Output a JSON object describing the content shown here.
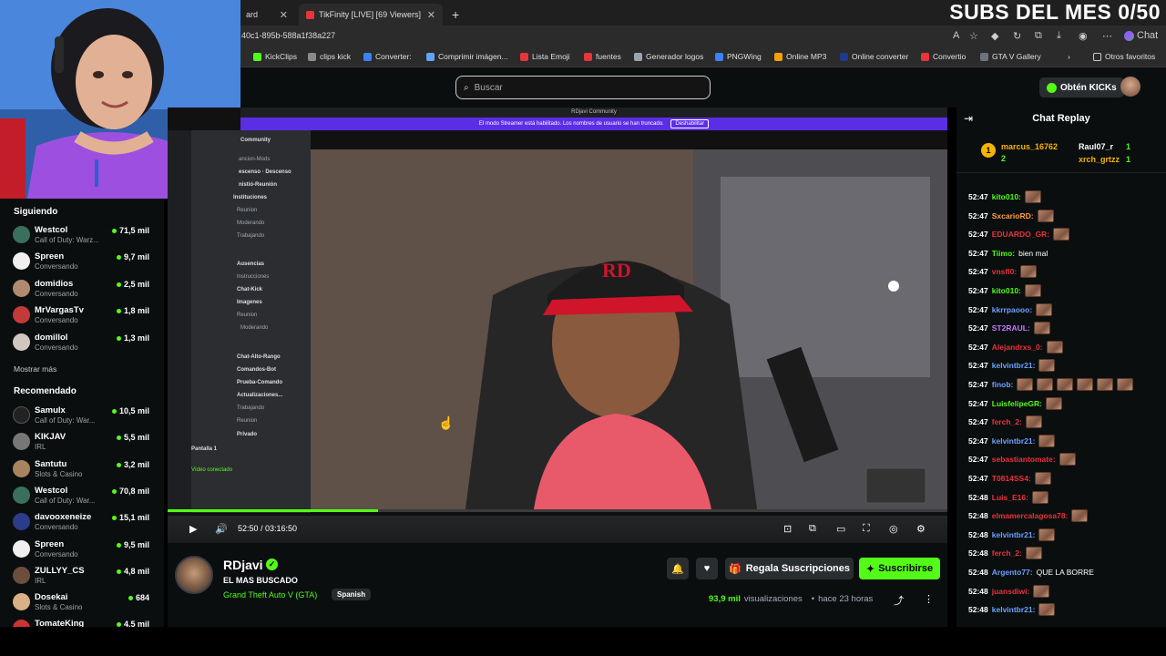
{
  "browser": {
    "tabs": [
      {
        "label": "ard",
        "active": false
      },
      {
        "label": "TikFinity [LIVE] [69 Viewers]",
        "active": false
      }
    ],
    "url": "40c1-895b-588a1f38a227",
    "chat_label": "Chat",
    "bookmarks": [
      "KickClips",
      "clips kick",
      "Converter:",
      "Comprimir imágen...",
      "Lista Emoji",
      "fuentes",
      "Generador logos",
      "PNGWing",
      "Online MP3",
      "Online converter",
      "Convertio",
      "GTA V Gallery"
    ],
    "other_favorites": "Otros favoritos"
  },
  "overlay": {
    "subs": "SUBS DEL MES 0/50"
  },
  "header": {
    "search_placeholder": "Buscar",
    "get_kicks": "Obtén KICKs"
  },
  "sidebar": {
    "following_title": "Siguiendo",
    "following": [
      {
        "name": "Westcol",
        "category": "Call of Duty: Warz...",
        "viewers": "71,5 mil"
      },
      {
        "name": "Spreen",
        "category": "Conversando",
        "viewers": "9,7 mil"
      },
      {
        "name": "domidios",
        "category": "Conversando",
        "viewers": "2,5 mil"
      },
      {
        "name": "MrVargasTv",
        "category": "Conversando",
        "viewers": "1,8 mil"
      },
      {
        "name": "domillol",
        "category": "Conversando",
        "viewers": "1,3 mil"
      }
    ],
    "show_more": "Mostrar más",
    "recommended_title": "Recomendado",
    "recommended": [
      {
        "name": "Samulx",
        "category": "Call of Duty: War...",
        "viewers": "10,5 mil"
      },
      {
        "name": "KIKJAV",
        "category": "IRL",
        "viewers": "5,5 mil"
      },
      {
        "name": "Santutu",
        "category": "Slots & Casino",
        "viewers": "3,2 mil"
      },
      {
        "name": "Westcol",
        "category": "Call of Duty: War...",
        "viewers": "70,8 mil"
      },
      {
        "name": "davooxeneize",
        "category": "Conversando",
        "viewers": "15,1 mil"
      },
      {
        "name": "Spreen",
        "category": "Conversando",
        "viewers": "9,5 mil"
      },
      {
        "name": "ZULLYY_CS",
        "category": "IRL",
        "viewers": "4,8 mil"
      },
      {
        "name": "Dosekai",
        "category": "Slots & Casino",
        "viewers": "684"
      },
      {
        "name": "TomateKing",
        "category": "",
        "viewers": "4,5 mil"
      }
    ]
  },
  "video": {
    "discord_title": "RDjavi Community",
    "streamer_mode_text": "El modo Streamer está habilitado. Los nombres de usuario se han truncado.",
    "streamer_mode_button": "Deshabilitar",
    "discord_server": "Community",
    "discord_channels": [
      "Instituciones",
      "Reunion",
      "Moderando",
      "Trabajando",
      "Ausencias",
      "Instrucciones",
      "Chat-Kick",
      "Imagenes",
      "Reunion",
      "Moderando",
      "Chat-Alto-Rango",
      "Comandos-Bot",
      "Prueba-Comando",
      "Actualizaciones...",
      "Trabajando",
      "Reunion",
      "Privado"
    ],
    "discord_top_lines": [
      "ancion-Mods",
      "escenso · Descenso",
      "nistió-Reunión"
    ],
    "screen_share": "Pantalla 1",
    "video_connected": "Vídeo conectado",
    "time": "52:50 / 03:16:50",
    "progress": 0.27
  },
  "stream": {
    "name": "RDjavi",
    "title": "EL MAS BUSCADO",
    "category": "Grand Theft Auto V (GTA)",
    "language": "Spanish",
    "gift_subs": "Regala Suscripciones",
    "subscribe": "Suscribirse",
    "views_count": "93,9 mil",
    "views_label": "visualizaciones",
    "ago": "hace 23 horas"
  },
  "chat": {
    "title": "Chat Replay",
    "leaderboard": [
      {
        "name": "marcus_16762",
        "count": "2"
      },
      {
        "name": "Raul07_r",
        "count": "1"
      },
      {
        "name": "xrch_grtzz",
        "count": "1"
      }
    ],
    "messages": [
      {
        "time": "52:47",
        "user": "kito010:",
        "color": "#53fc18",
        "text": "",
        "emotes": 1
      },
      {
        "time": "52:47",
        "user": "SxcarioRD:",
        "color": "#ff9f40",
        "text": "",
        "emotes": 1
      },
      {
        "time": "52:47",
        "user": "EDUARDO_GR:",
        "color": "#e8343a",
        "text": "",
        "emotes": 1
      },
      {
        "time": "52:47",
        "user": "Tiimo:",
        "color": "#53fc18",
        "text": "bien mal",
        "emotes": 0
      },
      {
        "time": "52:47",
        "user": "vnsfl0:",
        "color": "#e8343a",
        "text": "",
        "emotes": 1
      },
      {
        "time": "52:47",
        "user": "kito010:",
        "color": "#53fc18",
        "text": "",
        "emotes": 1
      },
      {
        "time": "52:47",
        "user": "kkrrpaooo:",
        "color": "#6ba2ff",
        "text": "",
        "emotes": 1
      },
      {
        "time": "52:47",
        "user": "ST2RAUL:",
        "color": "#c27bff",
        "text": "",
        "emotes": 1
      },
      {
        "time": "52:47",
        "user": "Alejandrxs_0:",
        "color": "#e8343a",
        "text": "",
        "emotes": 1
      },
      {
        "time": "52:47",
        "user": "kelvintbr21:",
        "color": "#6ba2ff",
        "text": "",
        "emotes": 1
      },
      {
        "time": "52:47",
        "user": "finob:",
        "color": "#6ba2ff",
        "text": "",
        "emotes": 6
      },
      {
        "time": "52:47",
        "user": "LuisfelipeGR:",
        "color": "#53fc18",
        "text": "",
        "emotes": 1
      },
      {
        "time": "52:47",
        "user": "ferch_2:",
        "color": "#e8343a",
        "text": "",
        "emotes": 1
      },
      {
        "time": "52:47",
        "user": "kelvintbr21:",
        "color": "#6ba2ff",
        "text": "",
        "emotes": 1
      },
      {
        "time": "52:47",
        "user": "sebastiantomate:",
        "color": "#e8343a",
        "text": "",
        "emotes": 1
      },
      {
        "time": "52:47",
        "user": "T0814SS4:",
        "color": "#e8343a",
        "text": "",
        "emotes": 1
      },
      {
        "time": "52:48",
        "user": "Luis_E16:",
        "color": "#e8343a",
        "text": "",
        "emotes": 1
      },
      {
        "time": "52:48",
        "user": "elmamercalagosa78:",
        "color": "#e8343a",
        "text": "",
        "emotes": 1
      },
      {
        "time": "52:48",
        "user": "kelvintbr21:",
        "color": "#6ba2ff",
        "text": "",
        "emotes": 1
      },
      {
        "time": "52:48",
        "user": "ferch_2:",
        "color": "#e8343a",
        "text": "",
        "emotes": 1
      },
      {
        "time": "52:48",
        "user": "Argento77:",
        "color": "#6ba2ff",
        "text": "QUE LA BORRE",
        "emotes": 0
      },
      {
        "time": "52:48",
        "user": "juansdiwi:",
        "color": "#e8343a",
        "text": "",
        "emotes": 1
      },
      {
        "time": "52:48",
        "user": "kelvintbr21:",
        "color": "#6ba2ff",
        "text": "",
        "emotes": 1
      }
    ]
  }
}
